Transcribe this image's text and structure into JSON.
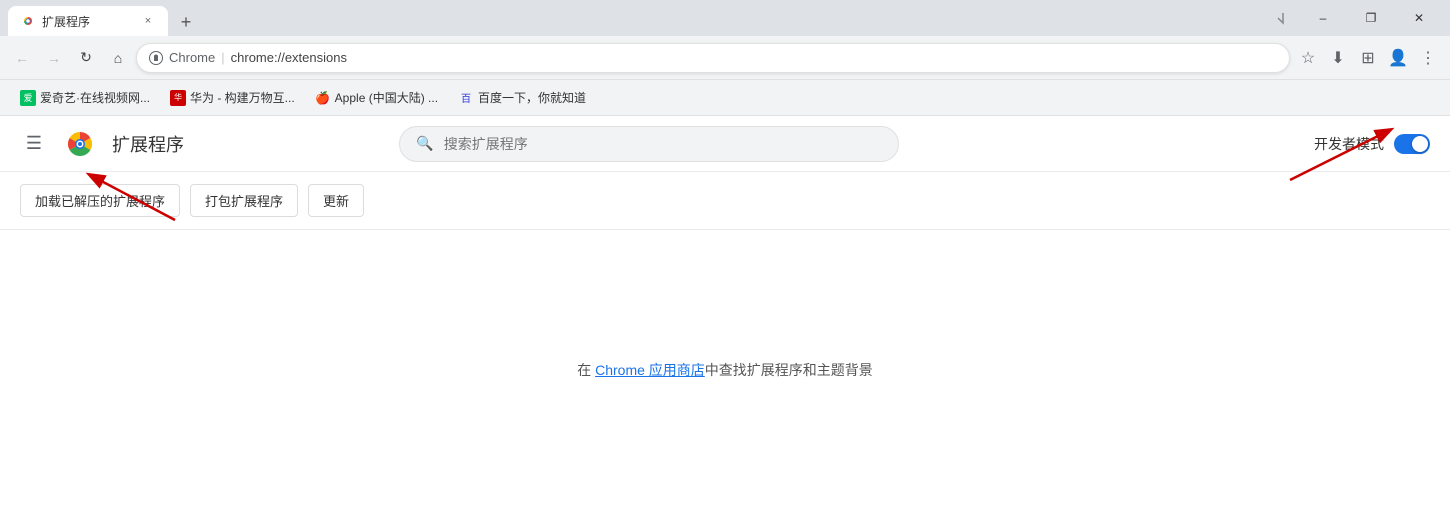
{
  "titlebar": {
    "tab_label": "扩展程序",
    "tab_close_label": "×",
    "new_tab_label": "+",
    "window_minimize": "–",
    "window_maximize": "□",
    "window_close": "✕",
    "window_restore": "❐"
  },
  "addressbar": {
    "back_icon": "←",
    "forward_icon": "→",
    "reload_icon": "↻",
    "home_icon": "⌂",
    "brand": "Chrome",
    "separator": "|",
    "url": "chrome://extensions",
    "bookmark_icon": "☆",
    "download_icon": "⬇",
    "profile_icon": "👤",
    "extensions_icon": "⊞",
    "menu_icon": "⋮"
  },
  "bookmarks": {
    "items": [
      {
        "label": "爱奇艺·在线视频网...",
        "color": "#00c060"
      },
      {
        "label": "华为 - 构建万物互...",
        "color": "#cc0000"
      },
      {
        "label": "Apple (中国大陆) ...",
        "color": "#555555"
      },
      {
        "label": "百度一下，你就知道",
        "color": "#2932e1"
      }
    ]
  },
  "extensions_page": {
    "menu_icon": "☰",
    "title": "扩展程序",
    "search_placeholder": "搜索扩展程序",
    "dev_mode_label": "开发者模式",
    "buttons": {
      "load_unpacked": "加载已解压的扩展程序",
      "pack_extension": "打包扩展程序",
      "update": "更新"
    },
    "empty_state_prefix": "在 ",
    "empty_state_link": "Chrome 应用商店",
    "empty_state_suffix": "中查找扩展程序和主题背景"
  }
}
